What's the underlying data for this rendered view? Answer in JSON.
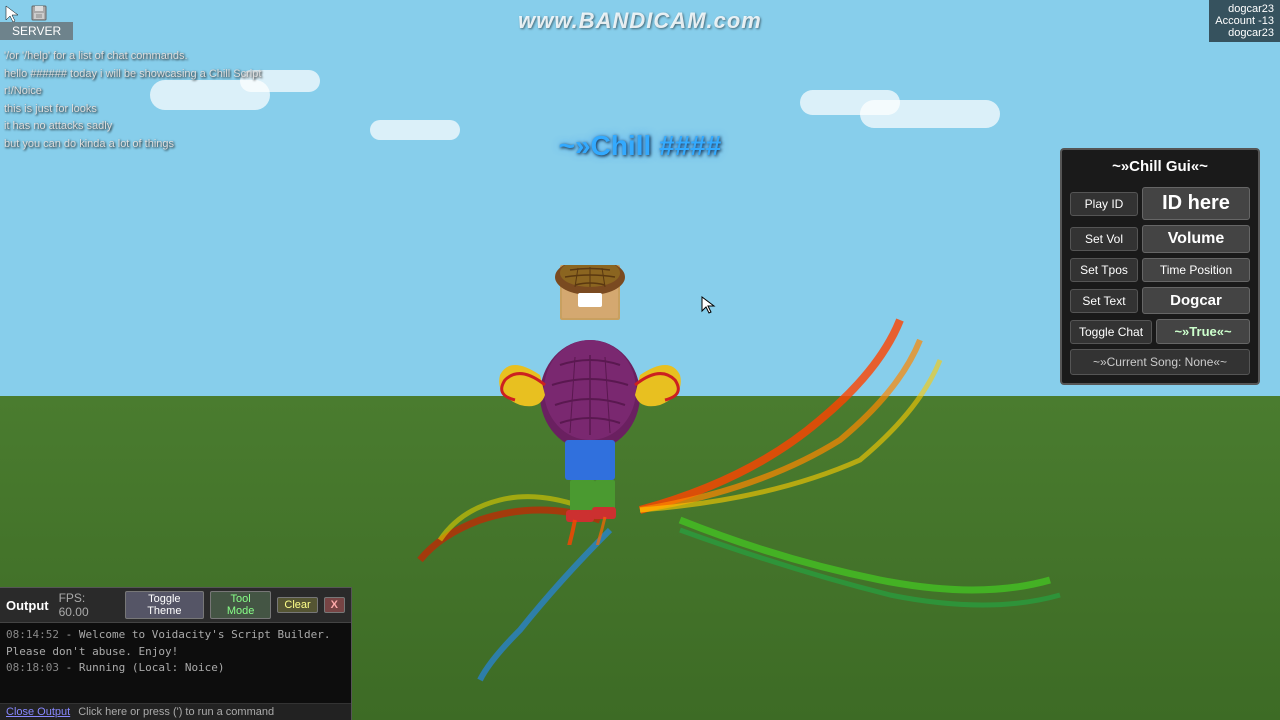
{
  "game": {
    "bg_sky_top": "#87CEEB",
    "bg_sky_bottom": "#9dd4f0",
    "bg_ground": "#4a7c2f"
  },
  "bandicam": {
    "text": "www.BANDICAM.com"
  },
  "user_info": {
    "username": "dogcar23",
    "account": "Account -13",
    "display": "dogcar23"
  },
  "server": {
    "label": "SERVER"
  },
  "chat": {
    "lines": [
      {
        "prefix": "",
        "text": "'/or '/help' for a list of chat commands."
      },
      {
        "prefix": "",
        "text": "hello ###### today i will be showcasing a Chill Script"
      },
      {
        "prefix": "",
        "text": "r!/Noice"
      },
      {
        "prefix": "",
        "text": "this is just for looks"
      },
      {
        "prefix": "",
        "text": "it has no attacks sadly"
      },
      {
        "prefix": "",
        "text": "but you can do kinda a lot of things"
      }
    ]
  },
  "float_title": {
    "text": "~»Chill  ####"
  },
  "chill_gui": {
    "title": "~»Chill Gui«~",
    "rows": [
      {
        "label": "Play ID",
        "value": "ID here",
        "value_style": "large"
      },
      {
        "label": "Set Vol",
        "value": "Volume",
        "value_style": "medium"
      },
      {
        "label": "Set Tpos",
        "value": "Time Position",
        "value_style": "tpos"
      },
      {
        "label": "Set Text",
        "value": "Dogcar",
        "value_style": "dogcar"
      },
      {
        "label": "Toggle Chat",
        "value": "~»True«~",
        "value_style": "true-val"
      }
    ],
    "footer": "~»Current Song: None«~"
  },
  "output_panel": {
    "label": "Output",
    "fps": "FPS: 60.00",
    "buttons": {
      "toggle_theme": "Toggle Theme",
      "tool_mode": "Tool Mode",
      "clear": "Clear",
      "close_x": "X"
    },
    "lines": [
      {
        "timestamp": "08:14:52",
        "text": " - Welcome to Voidacity's Script Builder. Please don't abuse. Enjoy!"
      },
      {
        "timestamp": "08:18:03",
        "text": " - Running (Local: Noice)"
      }
    ],
    "footer": {
      "close_btn": "Close Output",
      "run_hint": "Click here or press (') to run a command"
    }
  }
}
